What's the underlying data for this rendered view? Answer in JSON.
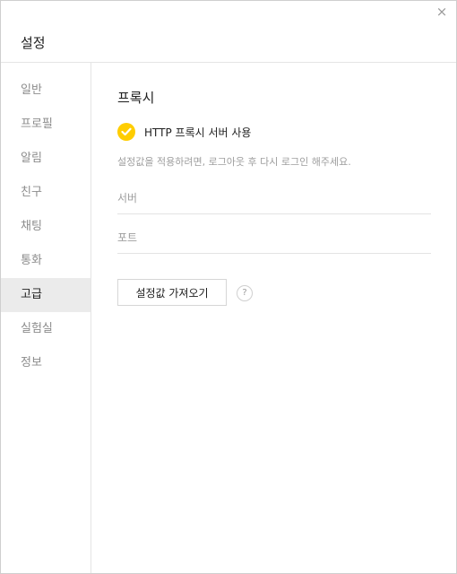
{
  "window": {
    "title": "설정",
    "close_glyph": "×"
  },
  "sidebar": {
    "items": [
      {
        "label": "일반"
      },
      {
        "label": "프로필"
      },
      {
        "label": "알림"
      },
      {
        "label": "친구"
      },
      {
        "label": "채팅"
      },
      {
        "label": "통화"
      },
      {
        "label": "고급",
        "active": true
      },
      {
        "label": "실험실"
      },
      {
        "label": "정보"
      }
    ]
  },
  "main": {
    "section_title": "프록시",
    "proxy_toggle": {
      "label": "HTTP 프록시 서버 사용",
      "checked": true
    },
    "hint": "설정값을 적용하려면, 로그아웃 후 다시 로그인 해주세요.",
    "server_field": {
      "placeholder": "서버",
      "value": ""
    },
    "port_field": {
      "placeholder": "포트",
      "value": ""
    },
    "import_button": "설정값 가져오기",
    "help_glyph": "?"
  },
  "colors": {
    "accent": "#ffcd00",
    "active_bg": "#ebebeb",
    "muted_text": "#8c8c8c",
    "divider": "#e5e5e5"
  },
  "icons": {
    "close": "close-icon",
    "check": "check-icon",
    "help": "help-icon"
  }
}
